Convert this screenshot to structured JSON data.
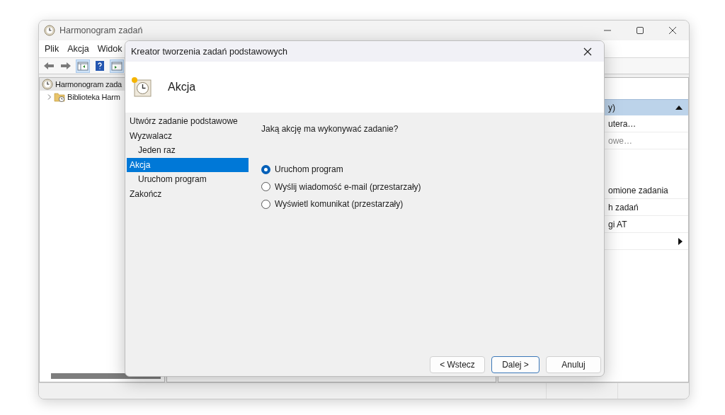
{
  "window": {
    "title": "Harmonogram zadań"
  },
  "menu": [
    "Plik",
    "Akcja",
    "Widok"
  ],
  "tree": [
    {
      "label": "Harmonogram zada",
      "selected": true,
      "children": [
        {
          "label": "Biblioteka Harm",
          "selected": false
        }
      ]
    }
  ],
  "actions_panel": {
    "header": {
      "label": "y)",
      "expanded": true
    },
    "items": [
      {
        "label": "utera…",
        "disabled": false,
        "kind": "action"
      },
      {
        "label": "owe…",
        "disabled": true,
        "kind": "action"
      },
      {
        "label": "omione zadania",
        "disabled": false,
        "kind": "action"
      },
      {
        "label": "h zadań",
        "disabled": false,
        "kind": "action"
      },
      {
        "label": "gi AT",
        "disabled": false,
        "kind": "action"
      },
      {
        "kind": "submenu"
      }
    ]
  },
  "dialog": {
    "title": "Kreator tworzenia zadań podstawowych",
    "heading": "Akcja",
    "steps": [
      {
        "label": "Utwórz zadanie podstawowe",
        "selected": false
      },
      {
        "label": "Wyzwalacz",
        "selected": false,
        "children": [
          {
            "label": "Jeden raz",
            "selected": false
          }
        ]
      },
      {
        "label": "Akcja",
        "selected": true,
        "children": [
          {
            "label": "Uruchom program",
            "selected": false
          }
        ]
      },
      {
        "label": "Zakończ",
        "selected": false
      }
    ],
    "question": "Jaką akcję ma wykonywać zadanie?",
    "options": [
      {
        "label": "Uruchom program",
        "selected": true
      },
      {
        "label": "Wyślij wiadomość e-mail (przestarzały)",
        "selected": false
      },
      {
        "label": "Wyświetl komunikat (przestarzały)",
        "selected": false
      }
    ],
    "buttons": [
      {
        "label": "< Wstecz",
        "default": false
      },
      {
        "label": "Dalej >",
        "default": true
      },
      {
        "label": "Anuluj",
        "default": false
      }
    ]
  }
}
